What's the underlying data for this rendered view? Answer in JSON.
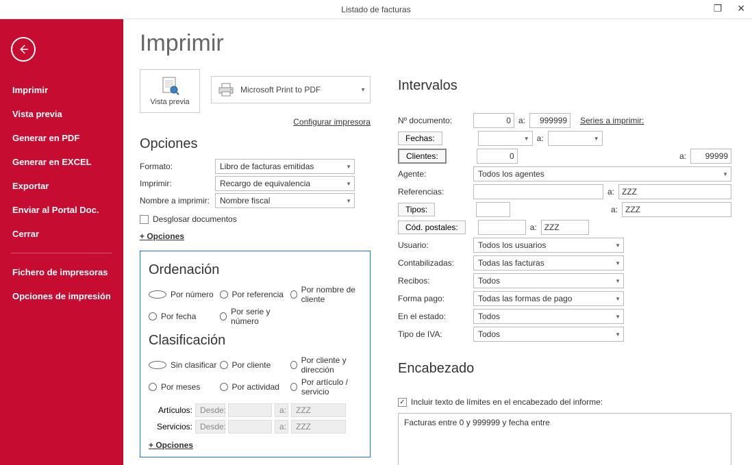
{
  "window": {
    "title": "Listado de facturas"
  },
  "sidebar": {
    "items": [
      "Imprimir",
      "Vista previa",
      "Generar en PDF",
      "Generar en EXCEL",
      "Exportar",
      "Enviar al Portal Doc.",
      "Cerrar"
    ],
    "bottom_items": [
      "Fichero de impresoras",
      "Opciones de impresión"
    ]
  },
  "page": {
    "title": "Imprimir"
  },
  "printarea": {
    "preview_label": "Vista previa",
    "printer_name": "Microsoft Print to PDF",
    "config_link": "Configurar impresora"
  },
  "opciones": {
    "heading": "Opciones",
    "formato_lbl": "Formato:",
    "formato_val": "Libro de facturas emitidas",
    "imprimir_lbl": "Imprimir:",
    "imprimir_val": "Recargo de equivalencia",
    "nombre_lbl": "Nombre a imprimir:",
    "nombre_val": "Nombre fiscal",
    "desglosar": "Desglosar documentos",
    "plus": "+ Opciones"
  },
  "ordenacion": {
    "heading": "Ordenación",
    "r1": "Por número",
    "r2": "Por referencia",
    "r3": "Por nombre de cliente",
    "r4": "Por fecha",
    "r5": "Por serie y número"
  },
  "clasificacion": {
    "heading": "Clasificación",
    "r1": "Sin clasificar",
    "r2": "Por cliente",
    "r3": "Por cliente y dirección",
    "r4": "Por meses",
    "r5": "Por actividad",
    "r6": "Por artículo / servicio",
    "art_lbl": "Artículos:",
    "srv_lbl": "Servicios:",
    "desde": "Desde:",
    "a": "a:",
    "zzz": "ZZZ",
    "plus": "+ Opciones"
  },
  "intervalos": {
    "heading": "Intervalos",
    "ndoc_lbl": "Nº documento:",
    "ndoc_from": "0",
    "ndoc_to": "999999",
    "series_link": "Series a imprimir:",
    "fechas_btn": "Fechas:",
    "a": "a:",
    "clientes_btn": "Clientes:",
    "cli_from": "0",
    "cli_to": "99999",
    "agente_lbl": "Agente:",
    "agente_val": "Todos los agentes",
    "ref_lbl": "Referencias:",
    "ref_to": "ZZZ",
    "tipos_btn": "Tipos:",
    "tipos_to": "ZZZ",
    "cp_btn": "Cód. postales:",
    "cp_to": "ZZZ",
    "usuario_lbl": "Usuario:",
    "usuario_val": "Todos los usuarios",
    "cont_lbl": "Contabilizadas:",
    "cont_val": "Todas las facturas",
    "recibos_lbl": "Recibos:",
    "recibos_val": "Todos",
    "fp_lbl": "Forma pago:",
    "fp_val": "Todas las formas de pago",
    "estado_lbl": "En el estado:",
    "estado_val": "Todos",
    "iva_lbl": "Tipo de IVA:",
    "iva_val": "Todos"
  },
  "encabezado": {
    "heading": "Encabezado",
    "chk_lbl": "Incluir texto de límites en el encabezado del informe:",
    "text": "Facturas entre 0 y 999999 y fecha entre"
  }
}
